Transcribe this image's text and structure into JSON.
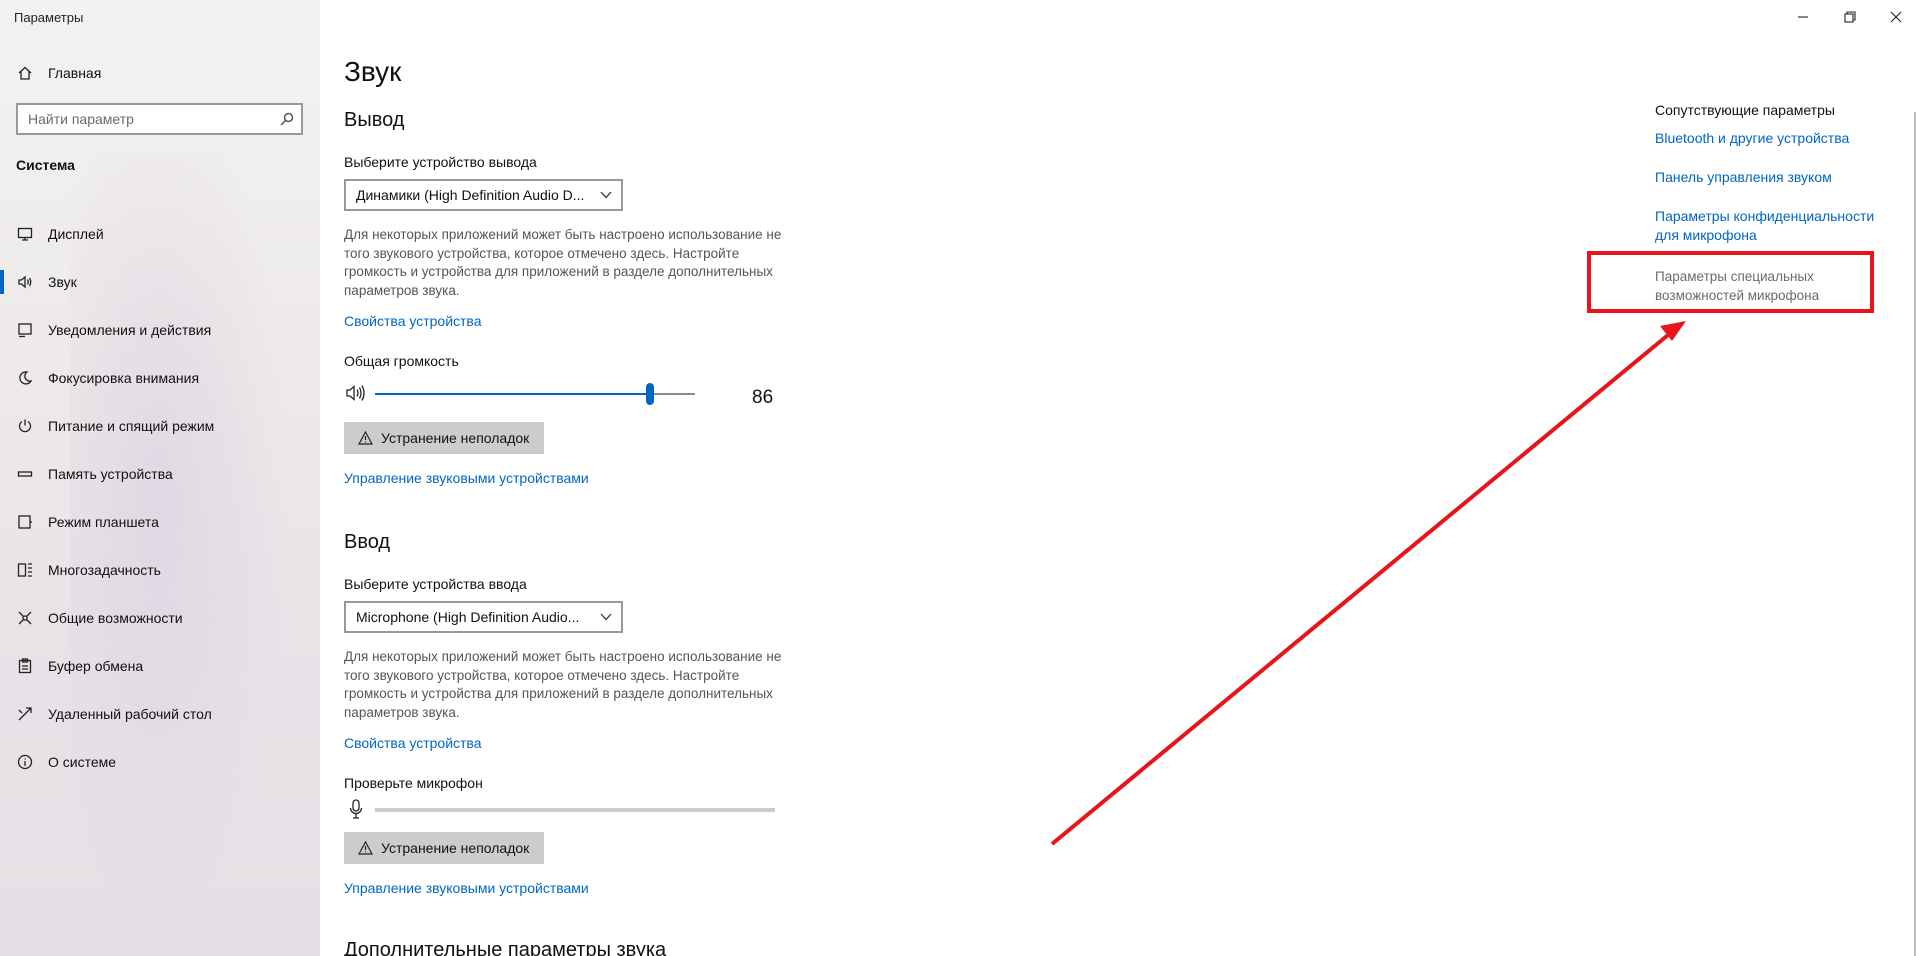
{
  "window": {
    "title": "Параметры",
    "controls": [
      "minimize-icon",
      "restore-icon",
      "close-icon"
    ]
  },
  "sidebar": {
    "home_label": "Главная",
    "search_placeholder": "Найти параметр",
    "section_title": "Система",
    "items": [
      {
        "label": "Дисплей",
        "icon": "display-icon"
      },
      {
        "label": "Звук",
        "icon": "speaker-icon",
        "active": true
      },
      {
        "label": "Уведомления и действия",
        "icon": "notifications-icon"
      },
      {
        "label": "Фокусировка внимания",
        "icon": "moon-icon"
      },
      {
        "label": "Питание и спящий режим",
        "icon": "power-icon"
      },
      {
        "label": "Память устройства",
        "icon": "storage-icon"
      },
      {
        "label": "Режим планшета",
        "icon": "tablet-icon"
      },
      {
        "label": "Многозадачность",
        "icon": "multitasking-icon"
      },
      {
        "label": "Общие возможности",
        "icon": "shared-icon"
      },
      {
        "label": "Буфер обмена",
        "icon": "clipboard-icon"
      },
      {
        "label": "Удаленный рабочий стол",
        "icon": "remote-desktop-icon"
      },
      {
        "label": "О системе",
        "icon": "info-icon"
      }
    ]
  },
  "main": {
    "page_title": "Звук",
    "output": {
      "heading": "Вывод",
      "select_label": "Выберите устройство вывода",
      "device": "Динамики (High Definition Audio D...",
      "description": "Для некоторых приложений может быть настроено использование не того звукового устройства, которое отмечено здесь. Настройте громкость и устройства для приложений в разделе дополнительных параметров звука.",
      "properties_link": "Свойства устройства",
      "volume_label": "Общая громкость",
      "volume_value": "86",
      "volume_fraction": 0.86,
      "troubleshoot_label": "Устранение неполадок",
      "manage_link": "Управление звуковыми устройствами"
    },
    "input": {
      "heading": "Ввод",
      "select_label": "Выберите устройства ввода",
      "device": "Microphone (High Definition Audio...",
      "description": "Для некоторых приложений может быть настроено использование не того звукового устройства, которое отмечено здесь. Настройте громкость и устройства для приложений в разделе дополнительных параметров звука.",
      "properties_link": "Свойства устройства",
      "test_label": "Проверьте микрофон",
      "troubleshoot_label": "Устранение неполадок",
      "manage_link": "Управление звуковыми устройствами"
    },
    "advanced_heading": "Дополнительные параметры звука"
  },
  "related": {
    "title": "Сопутствующие параметры",
    "links": [
      "Bluetooth и другие устройства",
      "Панель управления звуком",
      "Параметры конфиденциальности для микрофона"
    ],
    "highlighted": "Параметры специальных возможностей микрофона"
  },
  "colors": {
    "accent": "#0067c0",
    "annotation": "#e8141b"
  }
}
